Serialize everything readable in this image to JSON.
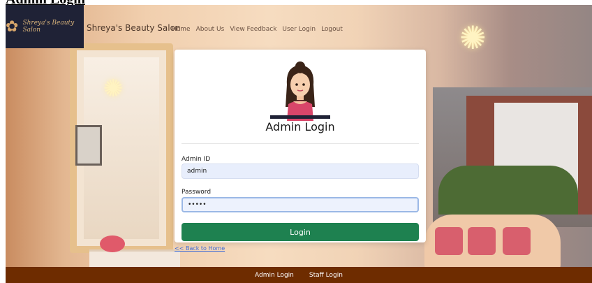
{
  "page": {
    "heading": "Admin Login"
  },
  "navbar": {
    "logo_text": "Shreya's Beauty Salon",
    "brand": "Shreya's Beauty Salon",
    "links": [
      {
        "label": "Home"
      },
      {
        "label": "About Us"
      },
      {
        "label": "View Feedback"
      },
      {
        "label": "User Login"
      },
      {
        "label": "Logout"
      }
    ]
  },
  "card": {
    "title": "Admin Login",
    "admin_id": {
      "label": "Admin ID",
      "value": "admin"
    },
    "password": {
      "label": "Password",
      "value": "•••••"
    },
    "login_button": "Login"
  },
  "back_link": "<< Back to Home",
  "footer": {
    "links": [
      {
        "label": "Admin Login"
      },
      {
        "label": "Staff Login"
      }
    ]
  },
  "colors": {
    "login_button": "#1e8150",
    "footer": "#6e2c00",
    "logo_bg": "#1f2236",
    "input_bg": "#e8eefc"
  }
}
